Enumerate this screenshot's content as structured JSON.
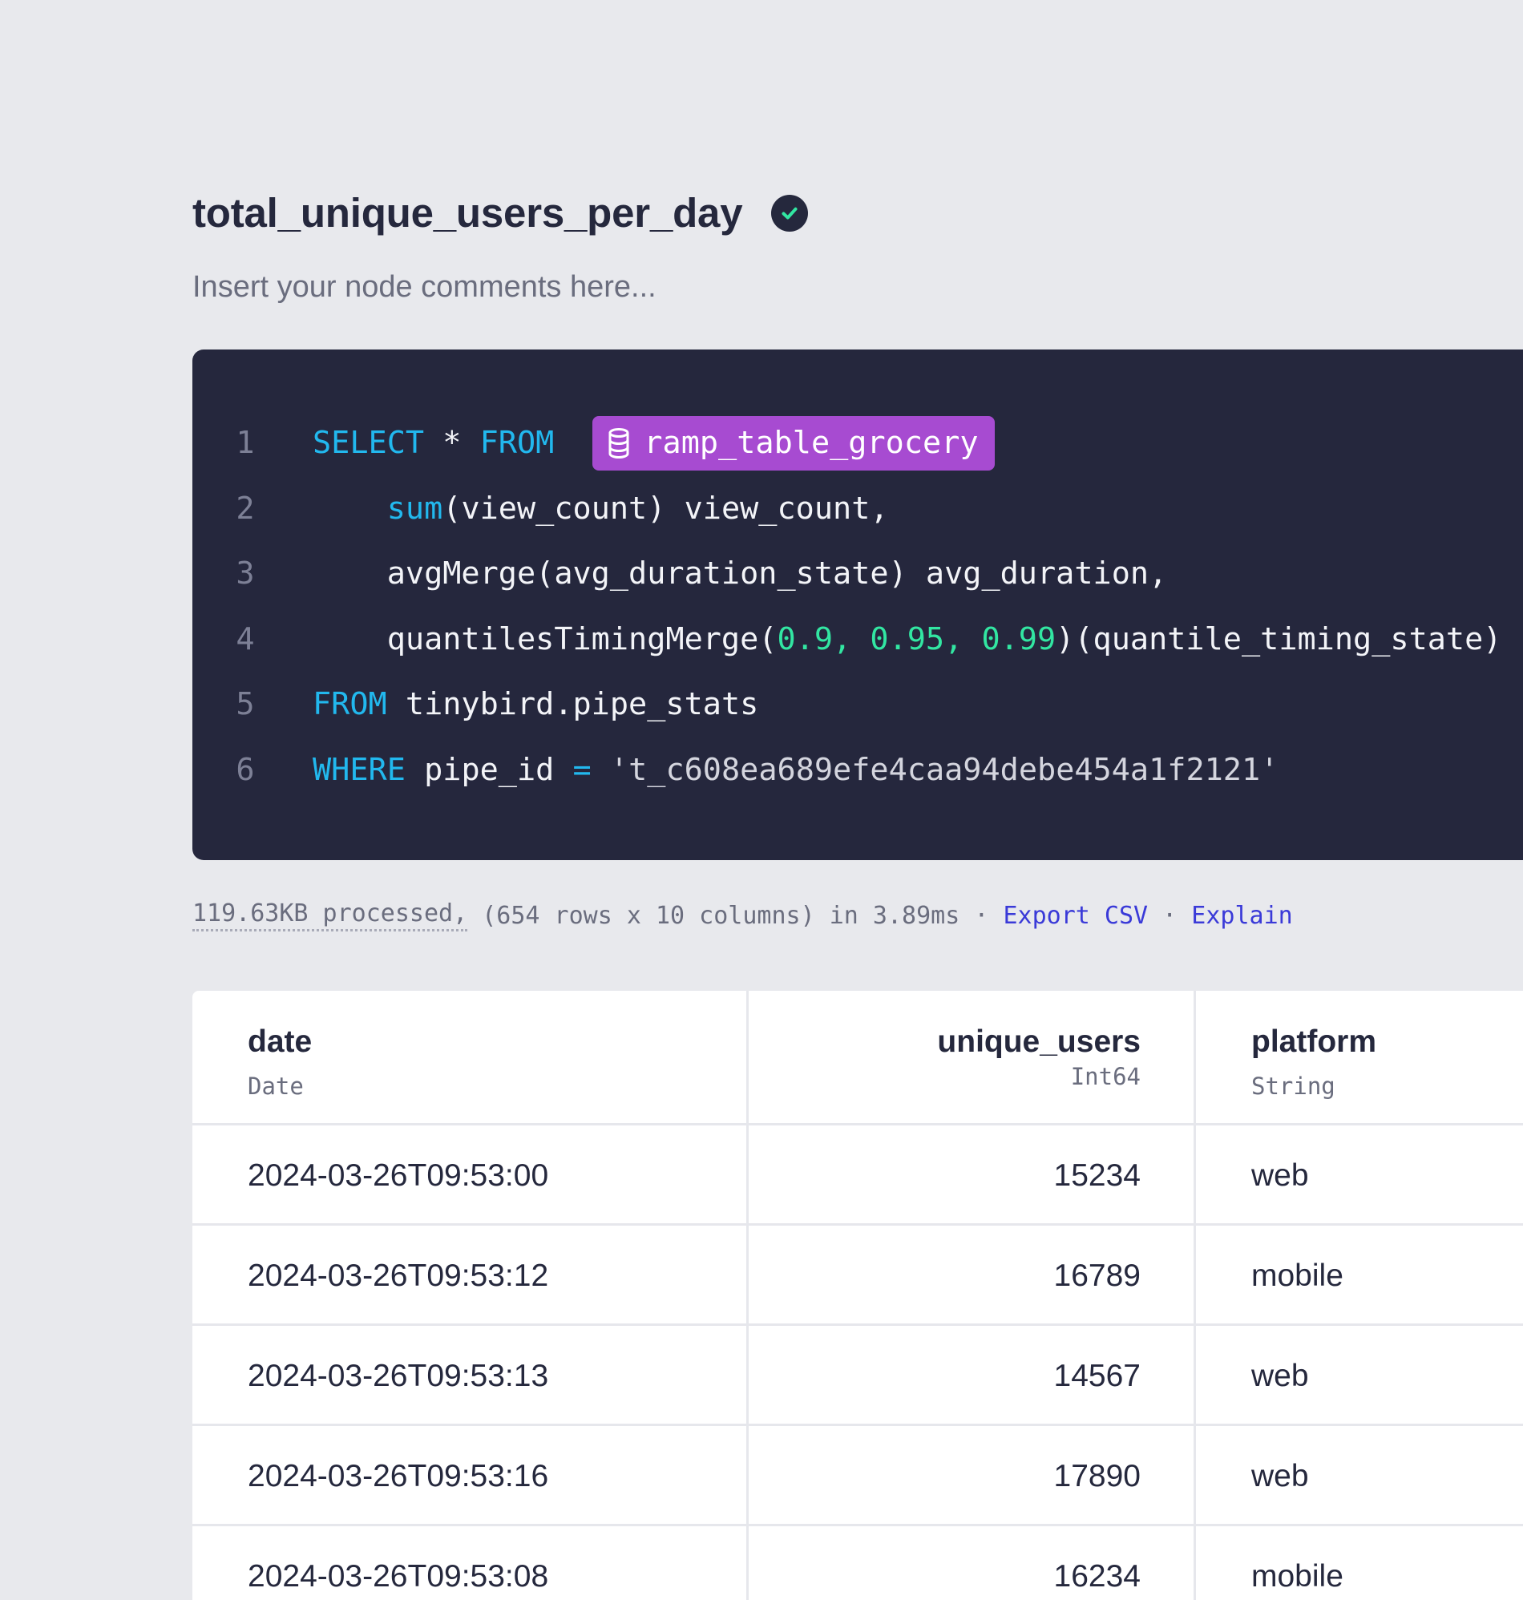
{
  "node": {
    "title": "total_unique_users_per_day",
    "comment_placeholder": "Insert your node comments here..."
  },
  "editor": {
    "lines": [
      {
        "n": "1",
        "tokens": [
          [
            "kw",
            "SELECT"
          ],
          [
            "plain",
            " * "
          ],
          [
            "kw",
            "FROM"
          ]
        ],
        "table_ref": "ramp_table_grocery"
      },
      {
        "n": "2",
        "tokens": [
          [
            "plain",
            "    "
          ],
          [
            "kw",
            "sum"
          ],
          [
            "plain",
            "(view_count) view_count,"
          ]
        ]
      },
      {
        "n": "3",
        "tokens": [
          [
            "plain",
            "    avgMerge(avg_duration_state) avg_duration,"
          ]
        ]
      },
      {
        "n": "4",
        "tokens": [
          [
            "plain",
            "    quantilesTimingMerge("
          ],
          [
            "num",
            "0.9, 0.95, 0.99"
          ],
          [
            "plain",
            ")(quantile_timing_state)"
          ]
        ]
      },
      {
        "n": "5",
        "tokens": [
          [
            "kw",
            "FROM"
          ],
          [
            "plain",
            " tinybird.pipe_stats"
          ]
        ]
      },
      {
        "n": "6",
        "tokens": [
          [
            "kw",
            "WHERE"
          ],
          [
            "plain",
            " pipe_id "
          ],
          [
            "kw",
            "="
          ],
          [
            "plain",
            " "
          ],
          [
            "str",
            "'t_c608ea689efe4caa94debe454a1f2121'"
          ]
        ]
      }
    ]
  },
  "stats": {
    "processed": "119.63KB processed,",
    "summary": " (654 rows x 10 columns) in 3.89ms ",
    "separator": "·",
    "export_label": "Export CSV",
    "explain_label": "Explain"
  },
  "table": {
    "columns": [
      {
        "name": "date",
        "type": "Date"
      },
      {
        "name": "unique_users",
        "type": "Int64"
      },
      {
        "name": "platform",
        "type": "String"
      }
    ],
    "rows": [
      [
        "2024-03-26T09:53:00",
        "15234",
        "web"
      ],
      [
        "2024-03-26T09:53:12",
        "16789",
        "mobile"
      ],
      [
        "2024-03-26T09:53:13",
        "14567",
        "web"
      ],
      [
        "2024-03-26T09:53:16",
        "17890",
        "web"
      ],
      [
        "2024-03-26T09:53:08",
        "16234",
        "mobile"
      ]
    ]
  },
  "colors": {
    "background": "#e8e9ed",
    "editor_bg": "#25273d",
    "keyword": "#22b8ee",
    "number": "#32e6a2",
    "table_chip": "#a74bd1",
    "link": "#3a3ad8",
    "success_check": "#32e6a2"
  },
  "icons": {
    "status": "check-circle-icon",
    "table_ref": "database-icon"
  }
}
